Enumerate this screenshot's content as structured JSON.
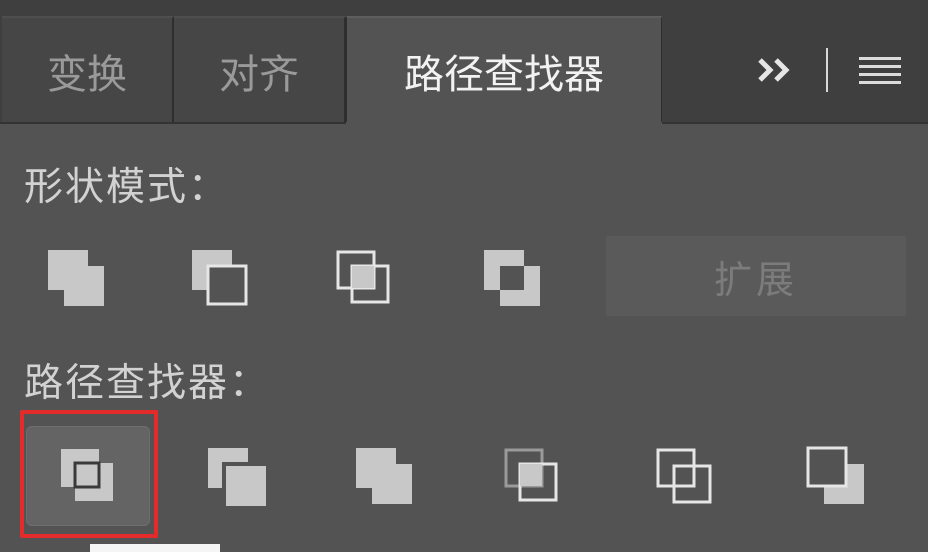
{
  "tabs": [
    {
      "label": "变换",
      "active": false
    },
    {
      "label": "对齐",
      "active": false
    },
    {
      "label": "路径查找器",
      "active": true
    }
  ],
  "panel_controls": {
    "expand_glyph": "›› ",
    "menu_icon": "hamburger-icon"
  },
  "shape_modes": {
    "label": "形状模式：",
    "buttons": [
      "unite-icon",
      "minus-front-icon",
      "intersect-icon",
      "exclude-icon"
    ],
    "expand_label": "扩展"
  },
  "pathfinders": {
    "label": "路径查找器：",
    "buttons": [
      "divide-icon",
      "trim-icon",
      "merge-icon",
      "crop-icon",
      "outline-icon",
      "minus-back-icon"
    ],
    "selected_index": 0
  },
  "colors": {
    "panel": "#535353",
    "tabbar": "#3f3f3f",
    "highlight": "#e32b2b",
    "icon_fill": "#c8c8c8"
  }
}
